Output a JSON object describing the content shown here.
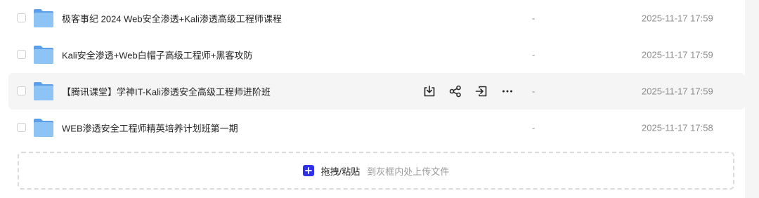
{
  "files": [
    {
      "name": "极客事纪 2024 Web安全渗透+Kali渗透高级工程师课程",
      "size": "-",
      "time": "2025-11-17 17:59"
    },
    {
      "name": "Kali安全渗透+Web白帽子高级工程师+黑客攻防",
      "size": "-",
      "time": "2025-11-17 17:59"
    },
    {
      "name": "【腾讯课堂】学神IT-Kali渗透安全高级工程师进阶班",
      "size": "-",
      "time": "2025-11-17 17:59"
    },
    {
      "name": "WEB渗透安全工程师精英培养计划班第一期",
      "size": "-",
      "time": "2025-11-17 17:58"
    }
  ],
  "row_actions": [
    "download-icon",
    "share-icon",
    "move-icon",
    "more-icon"
  ],
  "upload": {
    "main": "拖拽/粘贴",
    "hint": "到灰框内处上传文件"
  },
  "colors": {
    "accent": "#3131e8",
    "folder": "#7eb7f2",
    "hover_row": "#f5f5f6"
  }
}
